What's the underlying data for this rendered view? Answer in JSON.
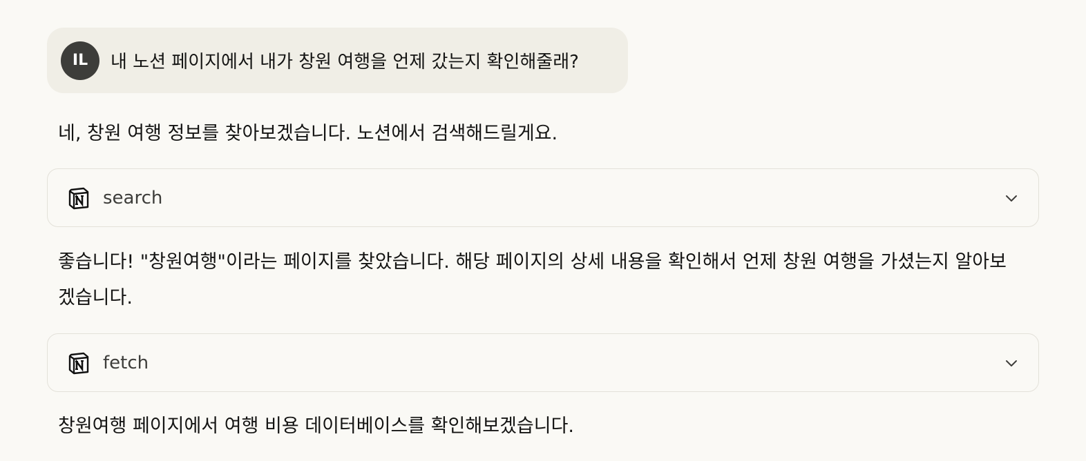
{
  "user_message": {
    "avatar_initials": "IL",
    "text": "내 노션 페이지에서 내가 창원 여행을 언제 갔는지 확인해줄래?"
  },
  "assistant": {
    "msg1": "네, 창원 여행 정보를 찾아보겠습니다. 노션에서 검색해드릴게요.",
    "tool1": {
      "icon": "notion-icon",
      "name": "search"
    },
    "msg2": "좋습니다! \"창원여행\"이라는 페이지를 찾았습니다. 해당 페이지의 상세 내용을 확인해서 언제 창원 여행을 가셨는지 알아보겠습니다.",
    "tool2": {
      "icon": "notion-icon",
      "name": "fetch"
    },
    "msg3": "창원여행 페이지에서 여행 비용 데이터베이스를 확인해보겠습니다."
  },
  "colors": {
    "background": "#faf9f5",
    "user_bubble": "#f0eee6",
    "avatar": "#3d3d3a",
    "card_border": "#e3e1d9"
  }
}
